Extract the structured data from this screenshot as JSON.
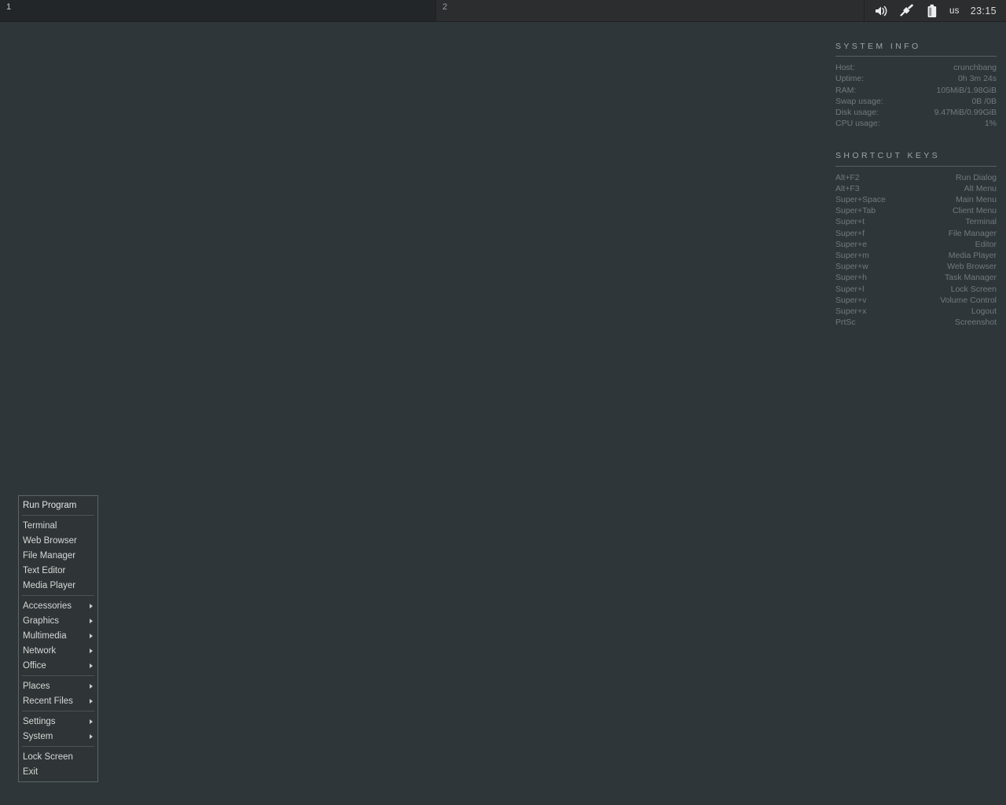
{
  "taskbar": {
    "workspaces": [
      {
        "label": "1",
        "active": true
      },
      {
        "label": "2",
        "active": false
      }
    ],
    "tray": {
      "volume_icon": "speaker-icon",
      "network_icon": "network-cable-icon",
      "battery_icon": "battery-icon",
      "keyboard_layout": "us",
      "clock": "23:15"
    }
  },
  "conky": {
    "system_info": {
      "heading": "SYSTEM INFO",
      "rows": [
        {
          "key": "Host:",
          "value": "crunchbang"
        },
        {
          "key": "Uptime:",
          "value": "0h 3m 24s"
        },
        {
          "key": "RAM:",
          "value": "105MiB/1.98GiB"
        },
        {
          "key": "Swap usage:",
          "value": "0B  /0B"
        },
        {
          "key": "Disk usage:",
          "value": "9.47MiB/0.99GiB"
        },
        {
          "key": "CPU usage:",
          "value": "1%"
        }
      ]
    },
    "shortcut_keys": {
      "heading": "SHORTCUT KEYS",
      "rows": [
        {
          "key": "Alt+F2",
          "value": "Run Dialog"
        },
        {
          "key": "Alt+F3",
          "value": "Alt Menu"
        },
        {
          "key": "Super+Space",
          "value": "Main Menu"
        },
        {
          "key": "Super+Tab",
          "value": "Client Menu"
        },
        {
          "key": "Super+t",
          "value": "Terminal"
        },
        {
          "key": "Super+f",
          "value": "File Manager"
        },
        {
          "key": "Super+e",
          "value": "Editor"
        },
        {
          "key": "Super+m",
          "value": "Media Player"
        },
        {
          "key": "Super+w",
          "value": "Web Browser"
        },
        {
          "key": "Super+h",
          "value": "Task Manager"
        },
        {
          "key": "Super+l",
          "value": "Lock Screen"
        },
        {
          "key": "Super+v",
          "value": "Volume Control"
        },
        {
          "key": "Super+x",
          "value": "Logout"
        },
        {
          "key": "PrtSc",
          "value": "Screenshot"
        }
      ]
    }
  },
  "root_menu": {
    "groups": [
      {
        "items": [
          {
            "label": "Run Program",
            "submenu": false
          }
        ]
      },
      {
        "items": [
          {
            "label": "Terminal",
            "submenu": false
          },
          {
            "label": "Web Browser",
            "submenu": false
          },
          {
            "label": "File Manager",
            "submenu": false
          },
          {
            "label": "Text Editor",
            "submenu": false
          },
          {
            "label": "Media Player",
            "submenu": false
          }
        ]
      },
      {
        "items": [
          {
            "label": "Accessories",
            "submenu": true
          },
          {
            "label": "Graphics",
            "submenu": true
          },
          {
            "label": "Multimedia",
            "submenu": true
          },
          {
            "label": "Network",
            "submenu": true
          },
          {
            "label": "Office",
            "submenu": true
          }
        ]
      },
      {
        "items": [
          {
            "label": "Places",
            "submenu": true
          },
          {
            "label": "Recent Files",
            "submenu": true
          }
        ]
      },
      {
        "items": [
          {
            "label": "Settings",
            "submenu": true
          },
          {
            "label": "System",
            "submenu": true
          }
        ]
      },
      {
        "items": [
          {
            "label": "Lock Screen",
            "submenu": false
          },
          {
            "label": "Exit",
            "submenu": false
          }
        ]
      }
    ]
  },
  "colors": {
    "desktop_bg": "#2f3639",
    "taskbar_bg": "#2b2d2e",
    "menu_bg": "#2f3436",
    "menu_border": "#5d6567",
    "conky_text": "#6f7a7c",
    "conky_heading": "#9aa5a6"
  }
}
